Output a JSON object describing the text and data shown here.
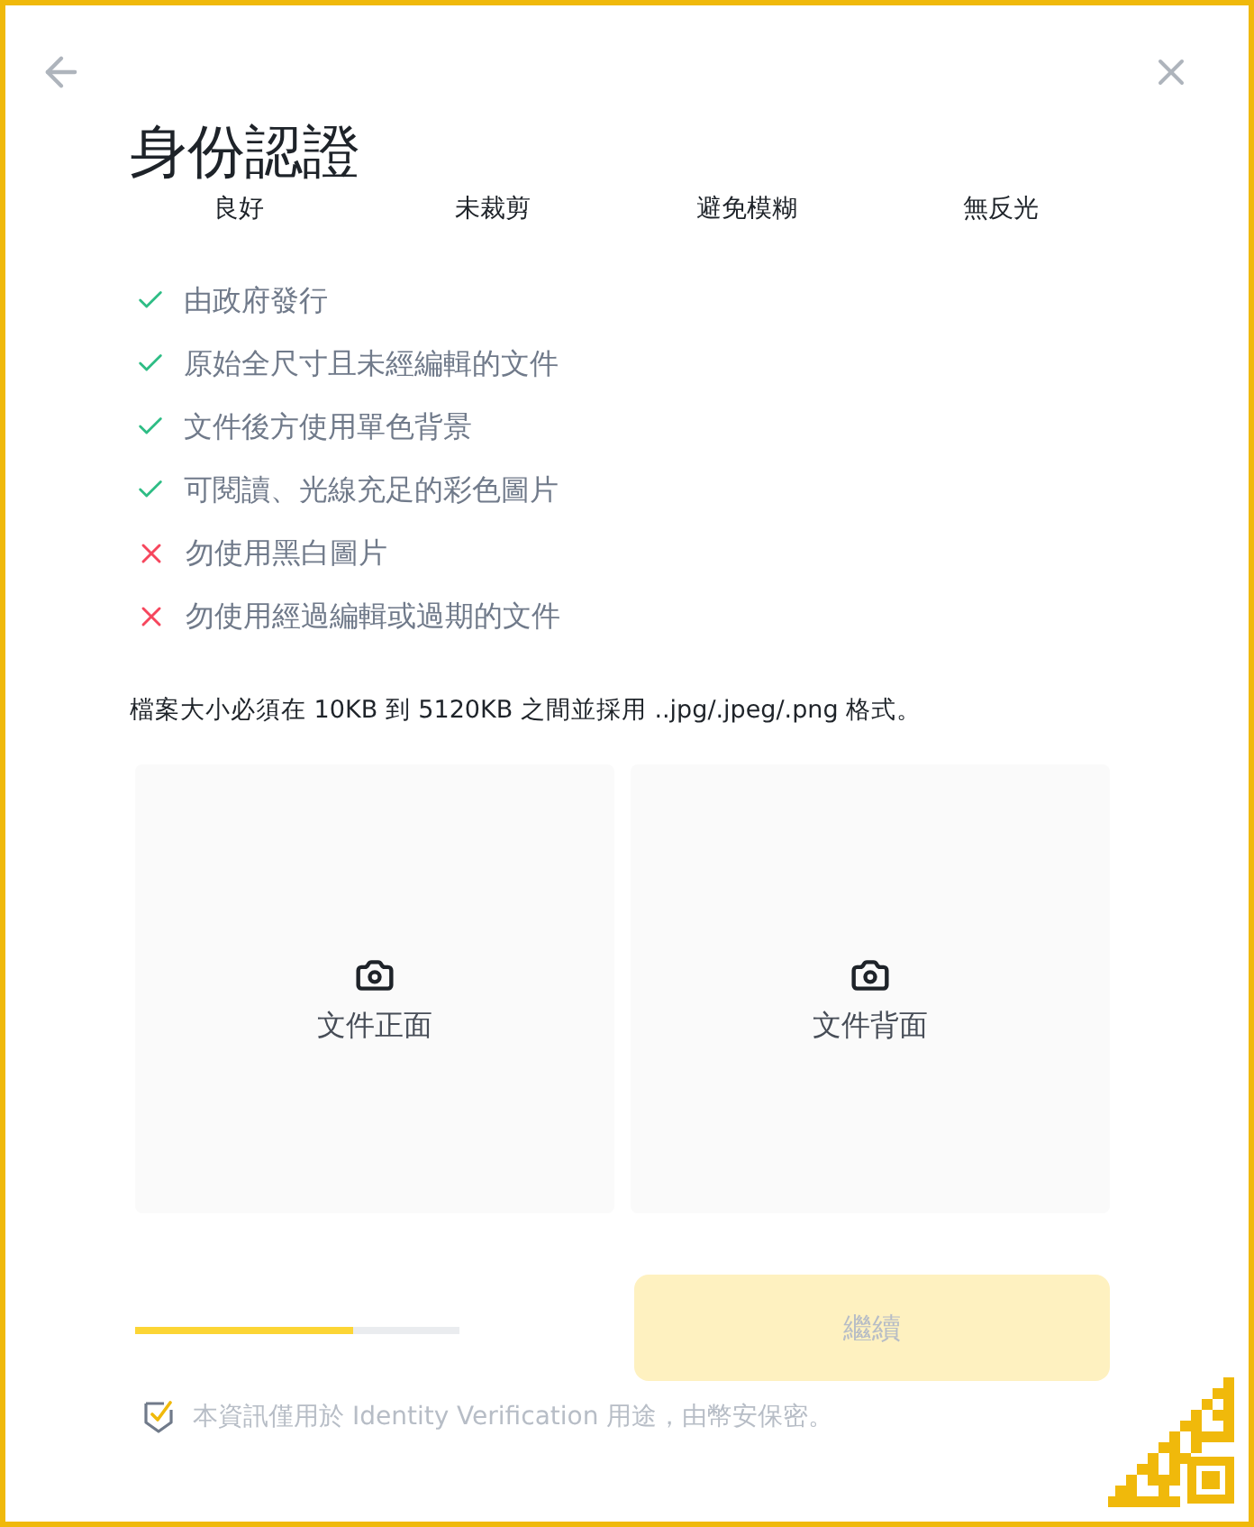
{
  "header": {
    "title": "身份認證"
  },
  "photo_examples": [
    "良好",
    "未裁剪",
    "避免模糊",
    "無反光"
  ],
  "requirements": [
    {
      "text": "由政府發行",
      "allowed": true
    },
    {
      "text": "原始全尺寸且未經編輯的文件",
      "allowed": true
    },
    {
      "text": "文件後方使用單色背景",
      "allowed": true
    },
    {
      "text": "可閱讀、光線充足的彩色圖片",
      "allowed": true
    },
    {
      "text": "勿使用黑白圖片",
      "allowed": false
    },
    {
      "text": "勿使用經過編輯或過期的文件",
      "allowed": false
    }
  ],
  "file_note": "檔案大小必須在 10KB 到 5120KB 之間並採用 ..jpg/.jpeg/.png 格式。",
  "upload_slots": [
    {
      "label": "文件正面"
    },
    {
      "label": "文件背面"
    }
  ],
  "progress": {
    "level": 0.67
  },
  "continue_button": {
    "label": "繼續",
    "disabled": true
  },
  "privacy_note": "本資訊僅用於 Identity Verification 用途，由幣安保密。"
}
